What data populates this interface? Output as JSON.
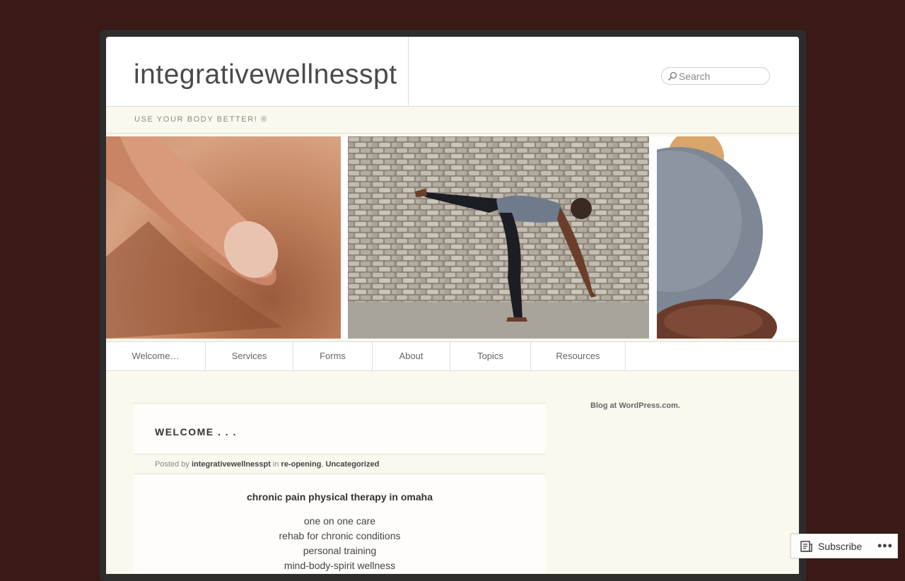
{
  "site": {
    "title": "integrativewellnesspt",
    "tagline": "USE YOUR BODY BETTER! ®"
  },
  "search": {
    "placeholder": "Search"
  },
  "nav": {
    "items": [
      "Welcome…",
      "Services",
      "Forms",
      "About",
      "Topics",
      "Resources"
    ]
  },
  "post": {
    "title": "WELCOME . . .",
    "meta": {
      "posted_by_label": "Posted by",
      "author": "integrativewellnesspt",
      "in_label": "in",
      "category1": "re-opening",
      "separator": ",",
      "category2": "Uncategorized"
    },
    "heading": "chronic pain physical therapy in omaha",
    "lines": [
      "one on one care",
      "rehab for chronic conditions",
      "personal training",
      "mind-body-spirit wellness"
    ]
  },
  "sidebar": {
    "credit": "Blog at WordPress.com."
  },
  "subscribe": {
    "label": "Subscribe",
    "more": "•••"
  },
  "colors": {
    "background": "#3a1a16",
    "page": "#fbf8ee",
    "accent_text": "#444444"
  }
}
